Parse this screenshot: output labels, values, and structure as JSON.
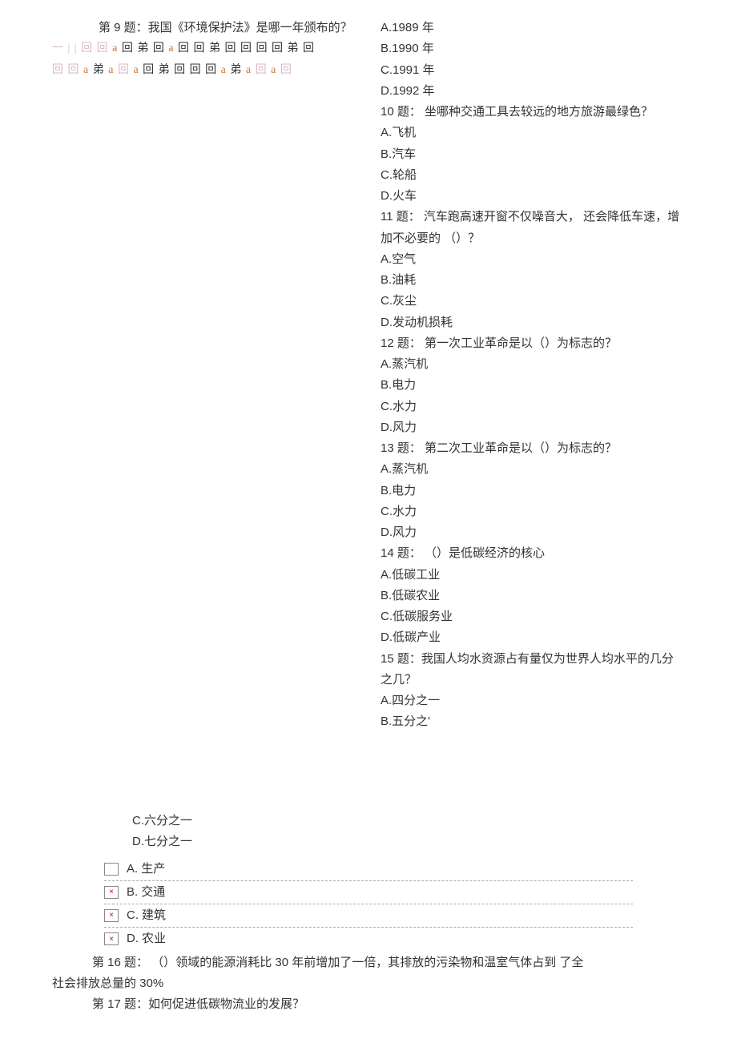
{
  "q9": {
    "title": "第 9 题：我国《环境保护法》是哪一年颁布的？",
    "ghost1_parts": [
      "一 | |",
      "回 回",
      "a",
      "回 弟 回",
      "a",
      "回 回 弟 回 回 回 回 弟 回"
    ],
    "ghost2_parts": [
      "回 回",
      "a",
      "弟",
      "a",
      "回",
      "a",
      "回 弟 回 回 回",
      "a",
      "弟",
      "a",
      "回",
      "a",
      "回"
    ],
    "options": {
      "A": "A.1989 年",
      "B": "B.1990 年",
      "C": "C.1991 年",
      "D": "D.1992 年"
    }
  },
  "q10": {
    "title": "10 题： 坐哪种交通工具去较远的地方旅游最绿色？",
    "options": {
      "A": "A.飞机",
      "B": "B.汽车",
      "C": "C.轮船",
      "D": "D.火车"
    }
  },
  "q11": {
    "title": "11 题： 汽车跑高速开窗不仅噪音大， 还会降低车速，增加不必要的 （）？",
    "options": {
      "A": "A.空气",
      "B": "B.油耗",
      "C": "C.灰尘",
      "D": "D.发动机损耗"
    }
  },
  "q12": {
    "title": "12 题： 第一次工业革命是以（）为标志的？",
    "options": {
      "A": "A.蒸汽机",
      "B": "B.电力",
      "C": "C.水力",
      "D": "D.风力"
    }
  },
  "q13": {
    "title": "13 题： 第二次工业革命是以（）为标志的？",
    "options": {
      "A": "A.蒸汽机",
      "B": "B.电力",
      "C": "C.水力",
      "D": "D.风力"
    }
  },
  "q14": {
    "title": "14 题： （）是低碳经济的核心",
    "options": {
      "A": "A.低碳工业",
      "B": "B.低碳农业",
      "C": "C.低碳服务业",
      "D": "D.低碳产业"
    }
  },
  "q15": {
    "title": "15 题：我国人均水资源占有量仅为世界人均水平的几分之几？",
    "options": {
      "A": "A.四分之一",
      "B": "B.五分之'",
      "C": "C.六分之一",
      "D": "D.七分之一"
    }
  },
  "extraOptions": {
    "A": {
      "label": "A.",
      "text": "生产"
    },
    "B": {
      "label": "B.",
      "text": "交通"
    },
    "C": {
      "label": "C.",
      "text": "建筑"
    },
    "D": {
      "label": "D.",
      "text": "农业"
    }
  },
  "q16": {
    "line1": "第 16 题： （）领域的能源消耗比 30 年前增加了一倍，其排放的污染物和温室气体占到  了全",
    "line2": "社会排放总量的 30%"
  },
  "q17": {
    "title": "第 17 题：如何促进低碳物流业的发展？"
  },
  "brokenGlyph": "×"
}
